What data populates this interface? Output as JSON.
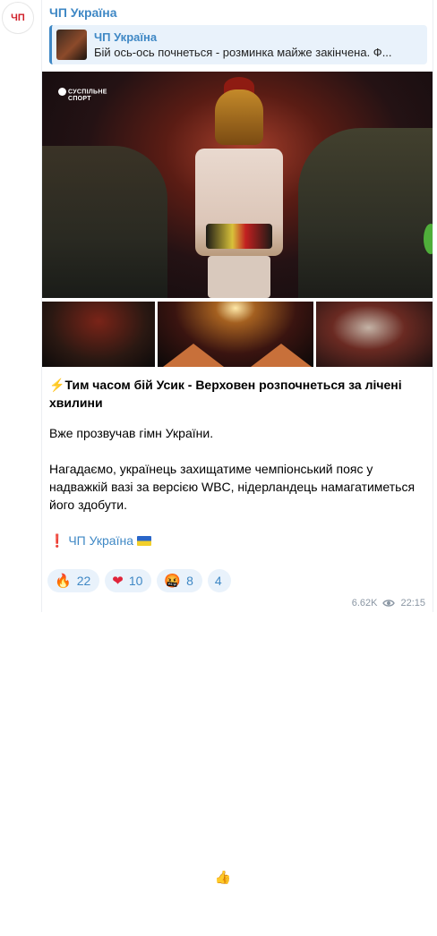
{
  "channel": {
    "avatar_text": "ЧП",
    "name": "ЧП Україна"
  },
  "reply": {
    "name": "ЧП Україна",
    "snippet": "Бій ось-ось почнеться - розминка майже закінчена. Ф..."
  },
  "photo": {
    "watermark_line1": "СУСПІЛЬНЕ",
    "watermark_line2": "СПОРТ",
    "fighter_badge": "BGY",
    "sponsor_badge": "OTEX"
  },
  "post": {
    "bolt": "⚡",
    "headline": "Тим часом бій Усик - Верховен розпочнеться за лічені хвилини",
    "para1": "Вже прозвучав гімн України.",
    "para2": "Нагадаємо, українець захищатиме чемпіонський пояс у надважкій вазі за версією WBC, нідерландець намагатиметься його здобути.",
    "sig_bang": "❗",
    "sig_link": "ЧП Україна"
  },
  "reactions": [
    {
      "emoji": "🔥",
      "count": "22",
      "icon": "fire-icon"
    },
    {
      "emoji": "❤",
      "count": "10",
      "icon": "heart-icon"
    },
    {
      "emoji": "🤬",
      "count": "8",
      "icon": "angry-face-icon"
    },
    {
      "emoji": "👍",
      "count": "4",
      "icon": "thumbs-up-icon"
    }
  ],
  "meta": {
    "views": "6.62K",
    "time": "22:15"
  },
  "colors": {
    "accent": "#3f88c5",
    "reaction_bg": "#e9f2fb",
    "meta": "#8a96a3"
  }
}
